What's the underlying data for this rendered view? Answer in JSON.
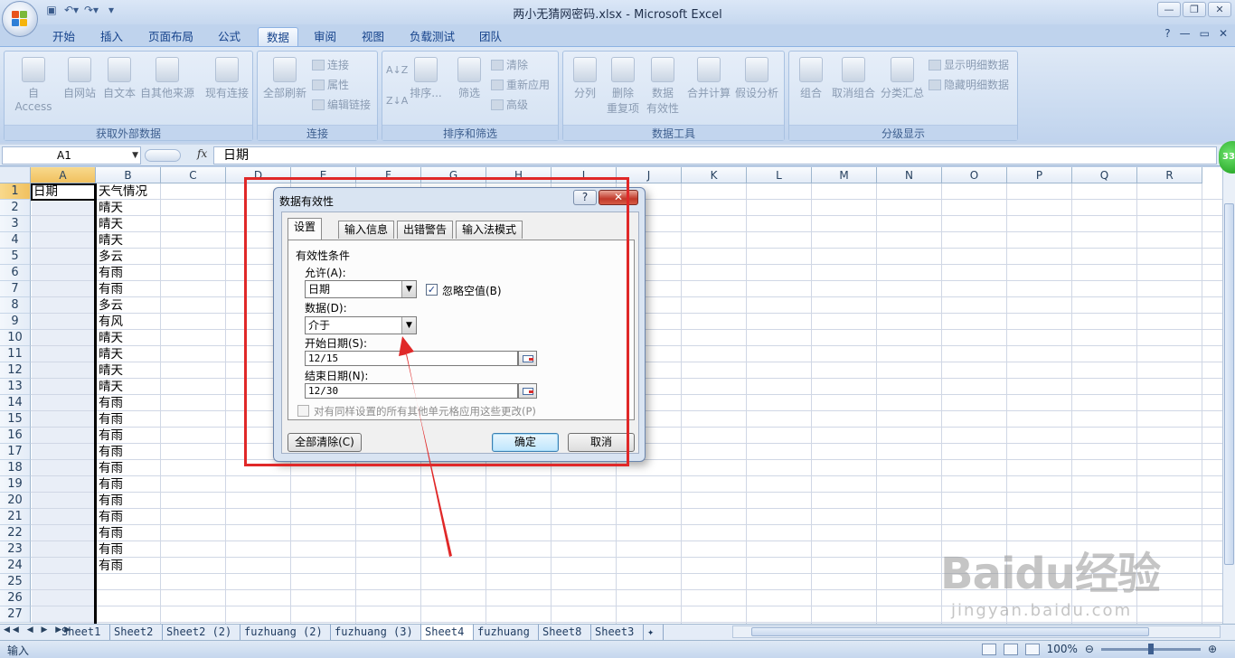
{
  "window": {
    "title": "两小无猜网密码.xlsx - Microsoft Excel"
  },
  "ribbon_tabs": [
    "开始",
    "插入",
    "页面布局",
    "公式",
    "数据",
    "审阅",
    "视图",
    "负载测试",
    "团队"
  ],
  "active_tab": "数据",
  "groups": {
    "external": {
      "label": "获取外部数据",
      "buttons": [
        "自 Access",
        "自网站",
        "自文本",
        "自其他来源",
        "现有连接"
      ]
    },
    "connection": {
      "label": "连接",
      "big": "全部刷新",
      "small": [
        "连接",
        "属性",
        "编辑链接"
      ]
    },
    "sort": {
      "label": "排序和筛选",
      "sort": "排序...",
      "filter": "筛选",
      "small": [
        "清除",
        "重新应用",
        "高级"
      ]
    },
    "datatools": {
      "label": "数据工具",
      "buttons": [
        "分列",
        "删除\n重复项",
        "数据\n有效性",
        "合并计算",
        "假设分析"
      ]
    },
    "outline": {
      "label": "分级显示",
      "buttons": [
        "组合",
        "取消组合",
        "分类汇总"
      ],
      "small": [
        "显示明细数据",
        "隐藏明细数据"
      ]
    }
  },
  "formula_bar": {
    "name_box": "A1",
    "fx": "fx",
    "content": "日期"
  },
  "columns": [
    "A",
    "B",
    "C",
    "D",
    "E",
    "F",
    "G",
    "H",
    "I",
    "J",
    "K",
    "L",
    "M",
    "N",
    "O",
    "P",
    "Q",
    "R"
  ],
  "rows": [
    "1",
    "2",
    "3",
    "4",
    "5",
    "6",
    "7",
    "8",
    "9",
    "10",
    "11",
    "12",
    "13",
    "14",
    "15",
    "16",
    "17",
    "18",
    "19",
    "20",
    "21",
    "22",
    "23",
    "24",
    "25",
    "26",
    "27"
  ],
  "cells": {
    "A1": "日期",
    "B": [
      "天气情况",
      "晴天",
      "晴天",
      "晴天",
      "多云",
      "有雨",
      "有雨",
      "多云",
      "有风",
      "晴天",
      "晴天",
      "晴天",
      "晴天",
      "有雨",
      "有雨",
      "有雨",
      "有雨",
      "有雨",
      "有雨",
      "有雨",
      "有雨",
      "有雨",
      "有雨",
      "有雨"
    ]
  },
  "dialog": {
    "title": "数据有效性",
    "help": "?",
    "close": "✕",
    "tabs": [
      "设置",
      "输入信息",
      "出错警告",
      "输入法模式"
    ],
    "section": "有效性条件",
    "allow_label": "允许(A):",
    "allow_value": "日期",
    "ignore_blank": "忽略空值(B)",
    "data_label": "数据(D):",
    "data_value": "介于",
    "start_label": "开始日期(S):",
    "start_value": "12/15",
    "end_label": "结束日期(N):",
    "end_value": "12/30",
    "apply_all": "对有同样设置的所有其他单元格应用这些更改(P)",
    "clear_all": "全部清除(C)",
    "ok": "确定",
    "cancel": "取消"
  },
  "sheets": [
    "Sheet1",
    "Sheet2",
    "Sheet2 (2)",
    "fuzhuang (2)",
    "fuzhuang (3)",
    "Sheet4",
    "fuzhuang",
    "Sheet8",
    "Sheet3"
  ],
  "active_sheet": "Sheet4",
  "status": {
    "mode": "输入",
    "zoom": "100%"
  },
  "badge": "33",
  "watermark": {
    "brand": "Baidu经验",
    "url": "jingyan.baidu.com"
  },
  "colors": {
    "highlight_red": "#e02828",
    "ribbon_blue": "#c9daf0",
    "selected_header": "#f1c15f"
  }
}
